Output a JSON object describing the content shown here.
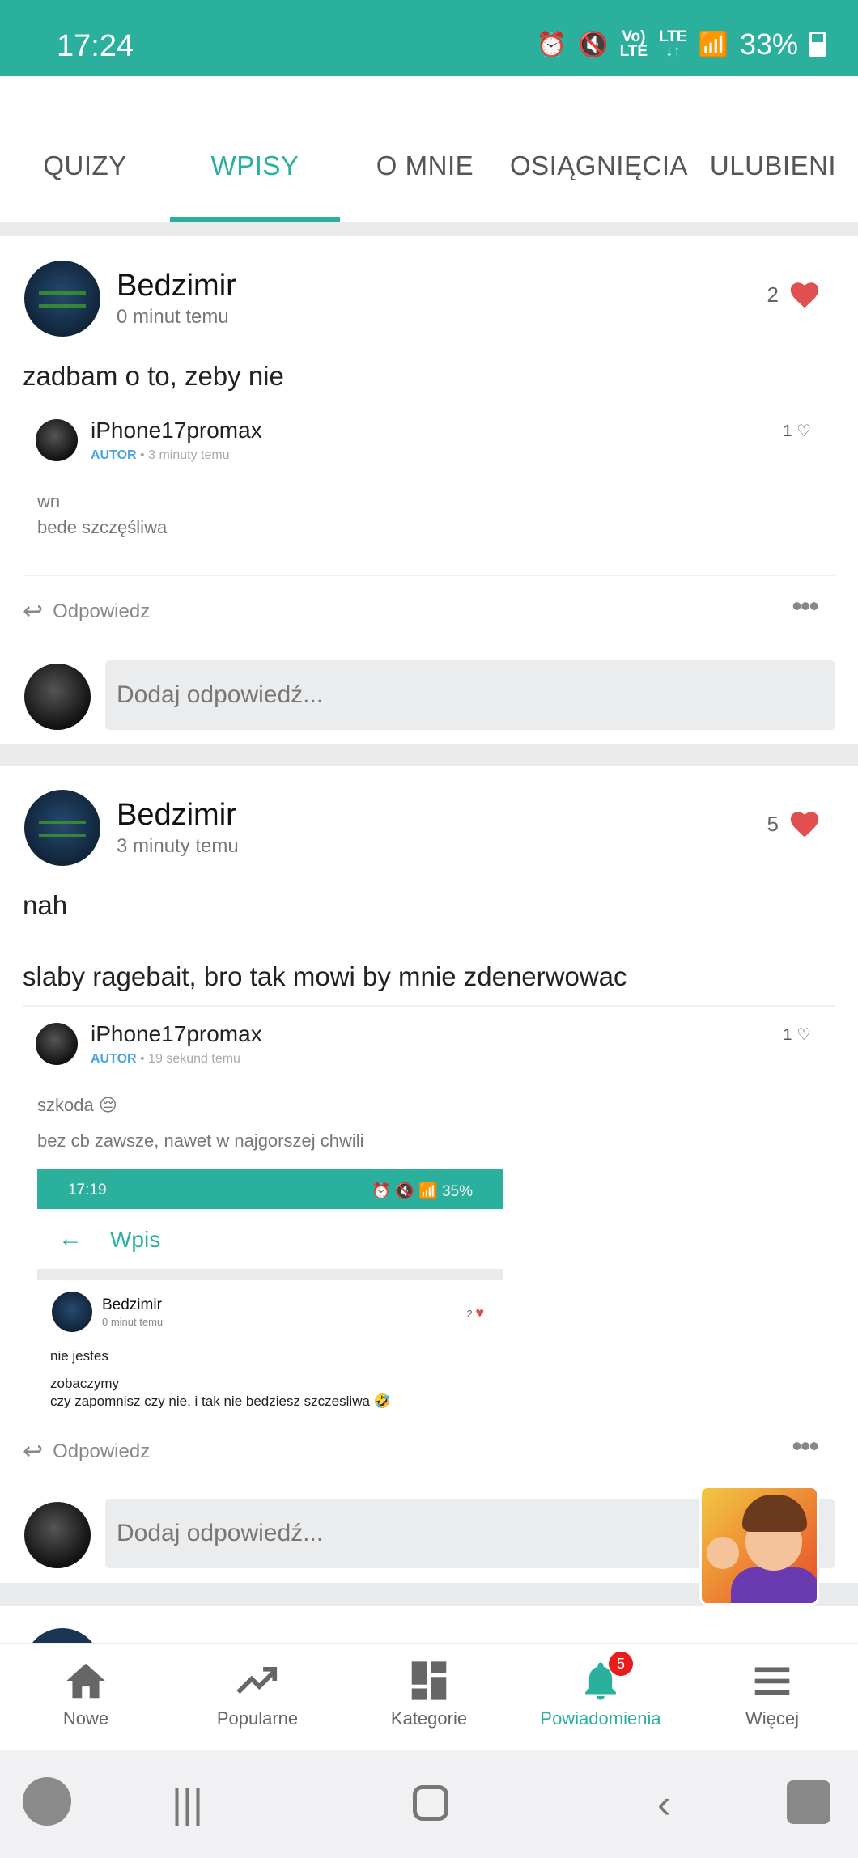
{
  "status_bar": {
    "time": "17:24",
    "lte_top": "Vo)",
    "lte_bottom": "LTE",
    "lte2_top": "LTE",
    "lte2_bottom": "↓↑",
    "battery": "33%"
  },
  "tabs": [
    {
      "label": "QUIZY",
      "active": false
    },
    {
      "label": "WPISY",
      "active": true
    },
    {
      "label": "O MNIE",
      "active": false
    },
    {
      "label": "OSIĄGNIĘCIA",
      "active": false
    },
    {
      "label": "ULUBIENI",
      "active": false
    }
  ],
  "posts": [
    {
      "author": "Bedzimir",
      "time": "0 minut temu",
      "likes": "2",
      "text": [
        "zadbam o to, zeby nie"
      ],
      "reply": {
        "author": "iPhone17promax",
        "badge": "AUTOR",
        "time": "3 minuty temu",
        "likes": "1",
        "lines": [
          "wn",
          "bede szczęśliwa"
        ]
      },
      "answer_label": "Odpowiedz",
      "input_placeholder": "Dodaj odpowiedź..."
    },
    {
      "author": "Bedzimir",
      "time": "3 minuty temu",
      "likes": "5",
      "text": [
        "nah",
        "slaby ragebait, bro tak mowi by mnie zdenerwowac"
      ],
      "reply": {
        "author": "iPhone17promax",
        "badge": "AUTOR",
        "time": "19 sekund temu",
        "likes": "1",
        "lines": [
          "szkoda 😔",
          "bez cb zawsze, nawet w najgorszej chwili"
        ],
        "screenshot": {
          "time": "17:19",
          "battery": "35%",
          "title": "Wpis",
          "author": "Bedzimir",
          "author_time": "0 minut temu",
          "likes": "2",
          "line1": "nie jestes",
          "line2": "zobaczymy",
          "line3": "czy zapomnisz czy nie, i tak nie bedziesz szczesliwa 🤣"
        }
      },
      "answer_label": "Odpowiedz",
      "input_placeholder": "Dodaj odpowiedź..."
    }
  ],
  "bottom_nav": [
    {
      "label": "Nowe",
      "icon": "home-icon",
      "active": false
    },
    {
      "label": "Popularne",
      "icon": "trending-icon",
      "active": false
    },
    {
      "label": "Kategorie",
      "icon": "categories-icon",
      "active": false
    },
    {
      "label": "Powiadomienia",
      "icon": "bell-icon",
      "active": true,
      "badge": "5"
    },
    {
      "label": "Więcej",
      "icon": "menu-icon",
      "active": false
    }
  ],
  "colors": {
    "accent": "#2bb09d",
    "heart": "#e15050",
    "badge": "#e81c1c"
  }
}
